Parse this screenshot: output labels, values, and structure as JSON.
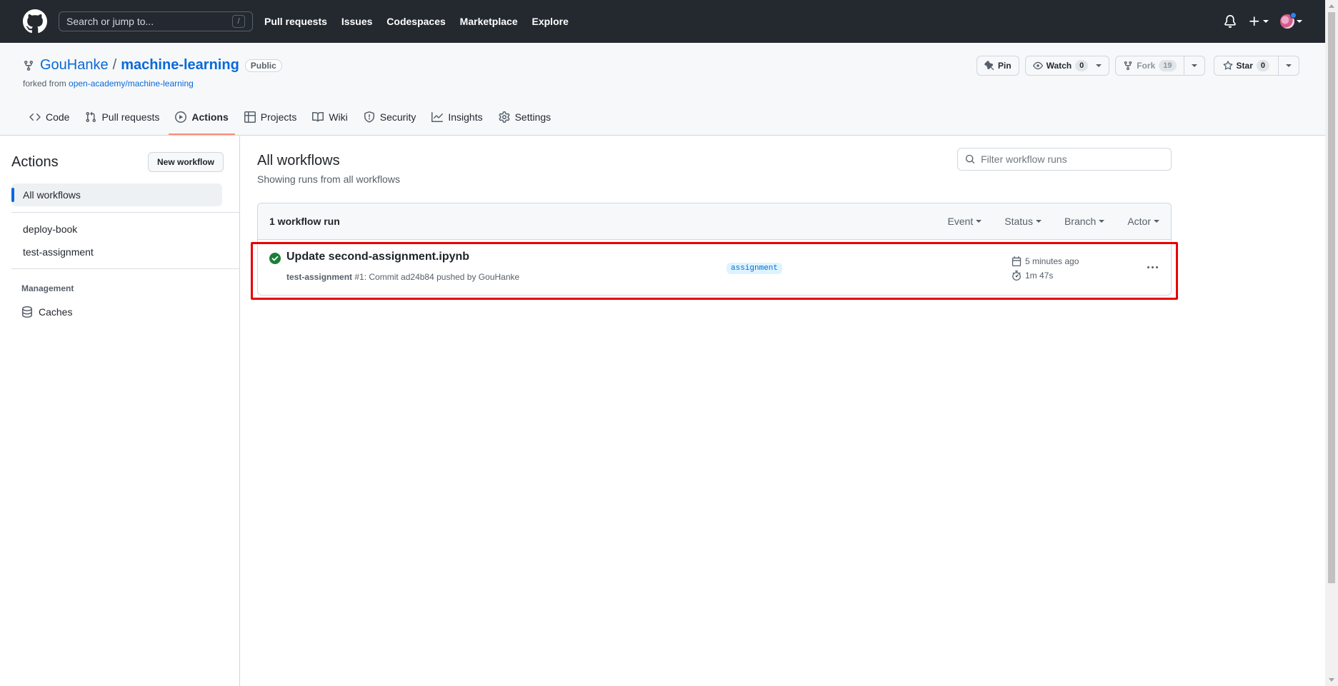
{
  "header": {
    "search_placeholder": "Search or jump to...",
    "search_key": "/",
    "nav": [
      "Pull requests",
      "Issues",
      "Codespaces",
      "Marketplace",
      "Explore"
    ]
  },
  "repo": {
    "owner": "GouHanke",
    "separator": "/",
    "name": "machine-learning",
    "visibility": "Public",
    "forked_prefix": "forked from ",
    "forked_from": "open-academy/machine-learning",
    "pin_label": "Pin",
    "watch_label": "Watch",
    "watch_count": "0",
    "fork_label": "Fork",
    "fork_count": "19",
    "star_label": "Star",
    "star_count": "0",
    "tabs": [
      "Code",
      "Pull requests",
      "Actions",
      "Projects",
      "Wiki",
      "Security",
      "Insights",
      "Settings"
    ],
    "active_tab": "Actions"
  },
  "sidebar": {
    "title": "Actions",
    "new_workflow": "New workflow",
    "all_workflows": "All workflows",
    "workflows": [
      "deploy-book",
      "test-assignment"
    ],
    "management_heading": "Management",
    "caches": "Caches"
  },
  "main": {
    "title": "All workflows",
    "subtitle": "Showing runs from all workflows",
    "filter_placeholder": "Filter workflow runs",
    "runs_count": "1 workflow run",
    "filters": [
      "Event",
      "Status",
      "Branch",
      "Actor"
    ],
    "run": {
      "title": "Update second-assignment.ipynb",
      "workflow": "test-assignment",
      "meta": " #1: Commit ad24b84 pushed by GouHanke",
      "branch": "assignment",
      "started": "5 minutes ago",
      "duration": "1m 47s",
      "status": "success"
    }
  },
  "colors": {
    "header_bg": "#24292f",
    "link": "#0969da",
    "success": "#1a7f37",
    "active_tab_underline": "#fd8c73",
    "highlight_box": "#e80000"
  }
}
